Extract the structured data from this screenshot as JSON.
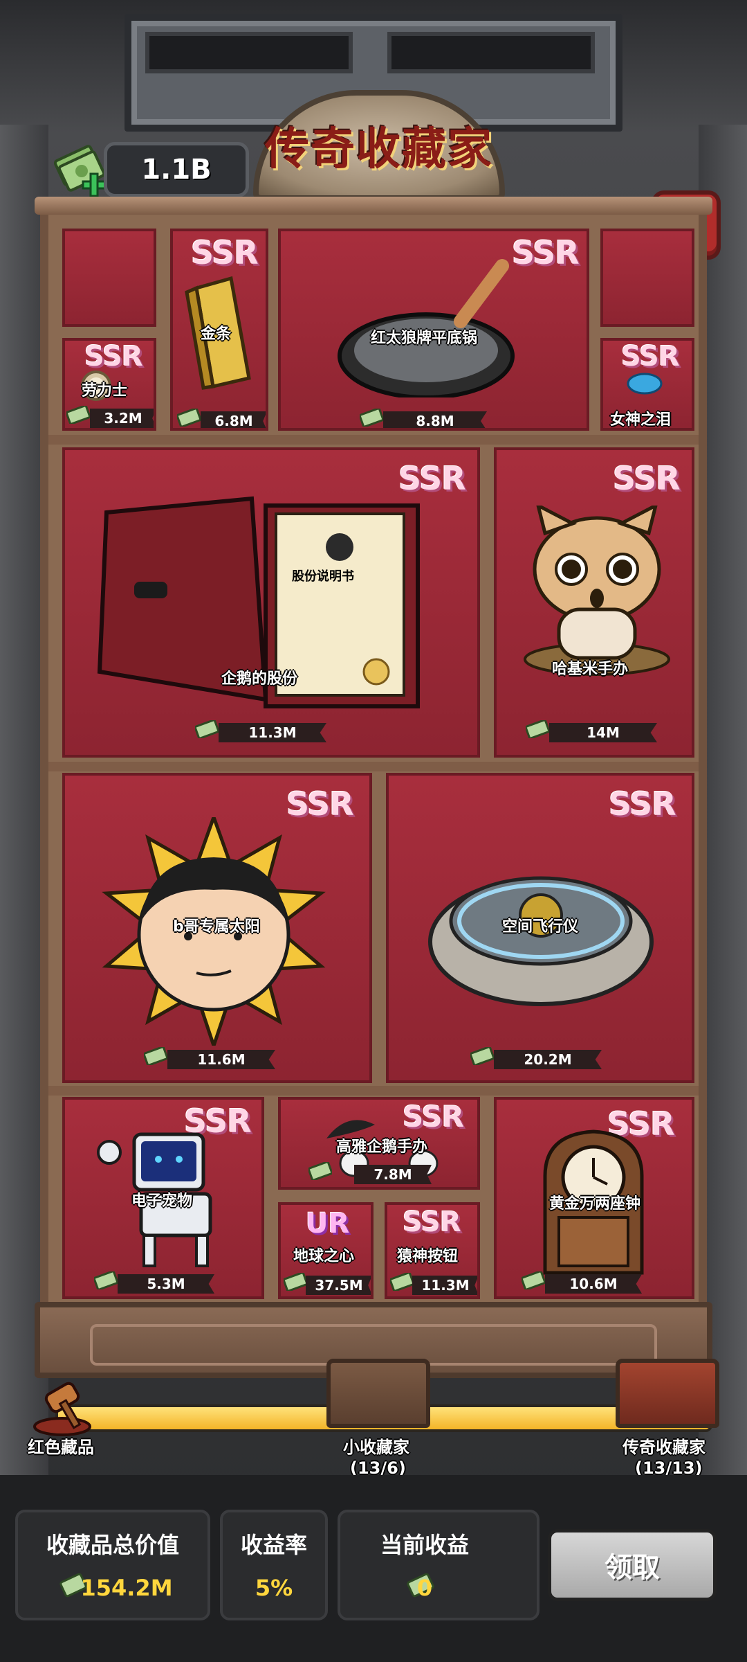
{
  "header": {
    "title": "传奇收藏家",
    "money": "1.1B"
  },
  "items": [
    {
      "name": "劳力士",
      "rarity": "SSR",
      "value": "3.2M"
    },
    {
      "name": "金条",
      "rarity": "SSR",
      "value": "6.8M"
    },
    {
      "name": "红太狼牌平底锅",
      "rarity": "SSR",
      "value": "8.8M"
    },
    {
      "name": "女神之泪",
      "rarity": "SSR",
      "value": ""
    },
    {
      "name": "企鹅的股份",
      "rarity": "SSR",
      "value": "11.3M",
      "doc_title": "股份说明书"
    },
    {
      "name": "哈基米手办",
      "rarity": "SSR",
      "value": "14M"
    },
    {
      "name": "b哥专属太阳",
      "rarity": "SSR",
      "value": "11.6M"
    },
    {
      "name": "空间飞行仪",
      "rarity": "SSR",
      "value": "20.2M"
    },
    {
      "name": "电子宠物",
      "rarity": "SSR",
      "value": "5.3M"
    },
    {
      "name": "高雅企鹅手办",
      "rarity": "SSR",
      "value": "7.8M"
    },
    {
      "name": "地球之心",
      "rarity": "UR",
      "value": "37.5M"
    },
    {
      "name": "猿神按钮",
      "rarity": "SSR",
      "value": "11.3M"
    },
    {
      "name": "黄金万两座钟",
      "rarity": "SSR",
      "value": "10.6M"
    }
  ],
  "progress": {
    "fraction": 1.0,
    "start_label": "红色藏品",
    "milestones": [
      {
        "label": "小收藏家",
        "count": "(13/6)"
      },
      {
        "label": "传奇收藏家",
        "count": "(13/13)"
      }
    ]
  },
  "footer": {
    "total_value_title": "收藏品总价值",
    "total_value": "154.2M",
    "rate_title": "收益率",
    "rate": "5%",
    "current_title": "当前收益",
    "current": "0",
    "claim_label": "领取"
  },
  "colors": {
    "slot_red": "#a82e3d",
    "gold": "#ffd63d",
    "close_red": "#b12d2b"
  }
}
